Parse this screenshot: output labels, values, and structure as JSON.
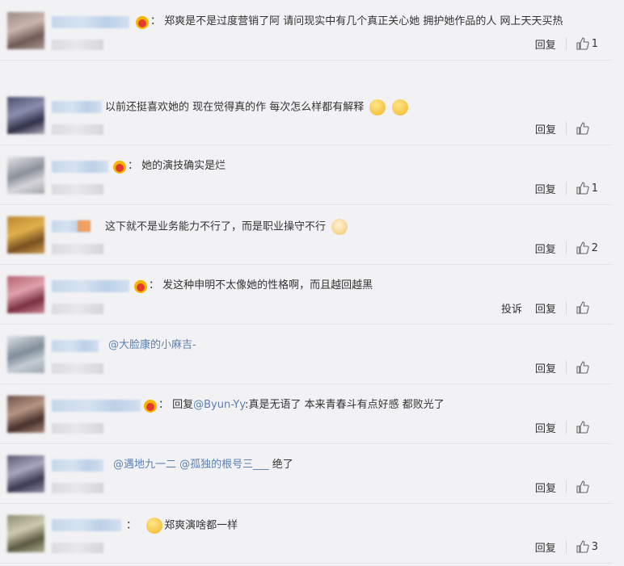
{
  "comments": [
    {
      "text": "：  郑爽是不是过度营销了阿 请问现实中有几个真正关心她 拥护她作品的人 网上天天买热",
      "reply_label": "回复",
      "like_count": "1",
      "crown": true
    },
    {
      "text": "以前还挺喜欢她的 现在觉得真的作 每次怎么样都有解释",
      "reply_label": "回复",
      "like_count": "",
      "crown": false
    },
    {
      "text": "：  她的演技确实是烂",
      "reply_label": "回复",
      "like_count": "1",
      "crown": true
    },
    {
      "text": "这下就不是业务能力不行了，而是职业操守不行",
      "reply_label": "回复",
      "like_count": "2",
      "crown": false
    },
    {
      "text": "：  发这种申明不太像她的性格啊，而且越回越黑",
      "report_label": "投诉",
      "reply_label": "回复",
      "like_count": "",
      "crown": true
    },
    {
      "mention": "@大脸康的小麻吉-",
      "reply_label": "回复",
      "like_count": "",
      "crown": false
    },
    {
      "prefix": "：  回复",
      "mention": "@Byun-Yy",
      "text": ":真是无语了 本来青春斗有点好感 都败光了",
      "reply_label": "回复",
      "like_count": "",
      "crown": true
    },
    {
      "mention": "@遇地九一二 @孤独的根号三___",
      "text": "  绝了",
      "reply_label": "回复",
      "like_count": "",
      "crown": false
    },
    {
      "prefix": "：",
      "text": "郑爽演啥都一样",
      "reply_label": "回复",
      "like_count": "3",
      "crown": false
    }
  ],
  "colors": {
    "background": "#f2f2f5",
    "mention": "#5b80b2",
    "divider": "#e4e4e8"
  },
  "icons": {
    "like": "thumbs-up-icon",
    "crown": "crown-badge-icon"
  }
}
